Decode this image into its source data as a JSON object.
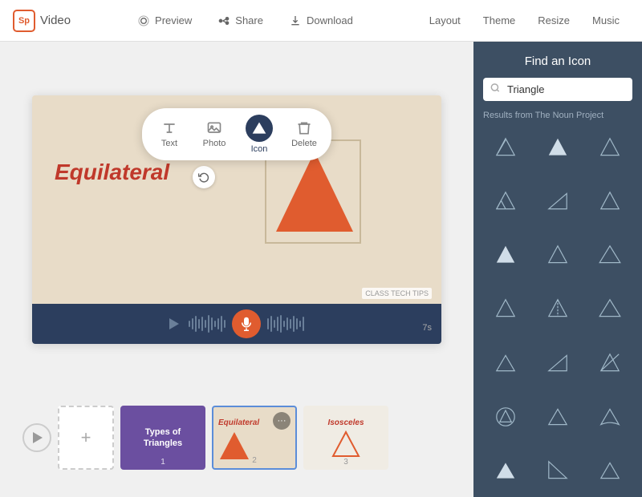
{
  "header": {
    "logo": "Sp",
    "app_title": "Video",
    "nav": {
      "preview": "Preview",
      "share": "Share",
      "download": "Download"
    },
    "right_nav": [
      "Layout",
      "Theme",
      "Resize",
      "Music"
    ]
  },
  "toolbar": {
    "items": [
      {
        "id": "text",
        "label": "Text"
      },
      {
        "id": "photo",
        "label": "Photo"
      },
      {
        "id": "icon",
        "label": "Icon",
        "active": true
      },
      {
        "id": "delete",
        "label": "Delete"
      }
    ]
  },
  "canvas": {
    "title": "Equilateral",
    "watermark": "CLASS TECH TIPS",
    "audio_time": "7s"
  },
  "panel": {
    "title": "Find an Icon",
    "search_placeholder": "Triangle",
    "results_label": "Results from The Noun Project"
  },
  "filmstrip": {
    "slides": [
      {
        "num": "1",
        "title": "Types of\nTriangles",
        "type": "purple"
      },
      {
        "num": "2",
        "title": "Equilateral",
        "type": "beige",
        "active": true
      },
      {
        "num": "3",
        "title": "Isosceles",
        "type": "light"
      }
    ]
  }
}
